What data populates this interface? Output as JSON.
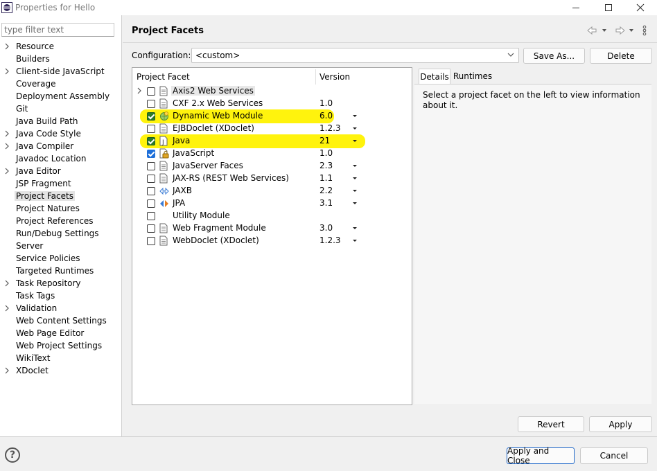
{
  "window": {
    "title": "Properties for Hello"
  },
  "filter": {
    "placeholder": "type filter text"
  },
  "sidebar": {
    "items": [
      {
        "label": "Resource",
        "expandable": true
      },
      {
        "label": "Builders",
        "expandable": false
      },
      {
        "label": "Client-side JavaScript",
        "expandable": true
      },
      {
        "label": "Coverage",
        "expandable": false
      },
      {
        "label": "Deployment Assembly",
        "expandable": false
      },
      {
        "label": "Git",
        "expandable": false
      },
      {
        "label": "Java Build Path",
        "expandable": false
      },
      {
        "label": "Java Code Style",
        "expandable": true
      },
      {
        "label": "Java Compiler",
        "expandable": true
      },
      {
        "label": "Javadoc Location",
        "expandable": false
      },
      {
        "label": "Java Editor",
        "expandable": true
      },
      {
        "label": "JSP Fragment",
        "expandable": false
      },
      {
        "label": "Project Facets",
        "expandable": false,
        "selected": true
      },
      {
        "label": "Project Natures",
        "expandable": false
      },
      {
        "label": "Project References",
        "expandable": false
      },
      {
        "label": "Run/Debug Settings",
        "expandable": false
      },
      {
        "label": "Server",
        "expandable": false
      },
      {
        "label": "Service Policies",
        "expandable": false
      },
      {
        "label": "Targeted Runtimes",
        "expandable": false
      },
      {
        "label": "Task Repository",
        "expandable": true
      },
      {
        "label": "Task Tags",
        "expandable": false
      },
      {
        "label": "Validation",
        "expandable": true
      },
      {
        "label": "Web Content Settings",
        "expandable": false
      },
      {
        "label": "Web Page Editor",
        "expandable": false
      },
      {
        "label": "Web Project Settings",
        "expandable": false
      },
      {
        "label": "WikiText",
        "expandable": false
      },
      {
        "label": "XDoclet",
        "expandable": true
      }
    ]
  },
  "page": {
    "title": "Project Facets"
  },
  "configuration": {
    "label": "Configuration:",
    "value": "<custom>",
    "save_as_label": "Save As...",
    "delete_label": "Delete"
  },
  "facet_table": {
    "headers": {
      "facet": "Project Facet",
      "version": "Version"
    },
    "rows": [
      {
        "name": "Axis2 Web Services",
        "version": "",
        "checked": false,
        "expander": true,
        "has_dropdown": false,
        "icon": "document-icon"
      },
      {
        "name": "CXF 2.x Web Services",
        "version": "1.0",
        "checked": false,
        "has_dropdown": false,
        "icon": "document-icon"
      },
      {
        "name": "Dynamic Web Module",
        "version": "6.0",
        "checked": true,
        "has_dropdown": true,
        "icon": "web-module-icon",
        "highlighted": true
      },
      {
        "name": "EJBDoclet (XDoclet)",
        "version": "1.2.3",
        "checked": false,
        "has_dropdown": true,
        "icon": "document-icon"
      },
      {
        "name": "Java",
        "version": "21",
        "checked": true,
        "has_dropdown": true,
        "icon": "java-icon",
        "highlighted": true
      },
      {
        "name": "JavaScript",
        "version": "1.0",
        "checked": true,
        "has_dropdown": false,
        "icon": "javascript-icon",
        "locked": true
      },
      {
        "name": "JavaServer Faces",
        "version": "2.3",
        "checked": false,
        "has_dropdown": true,
        "icon": "document-icon"
      },
      {
        "name": "JAX-RS (REST Web Services)",
        "version": "1.1",
        "checked": false,
        "has_dropdown": true,
        "icon": "document-icon"
      },
      {
        "name": "JAXB",
        "version": "2.2",
        "checked": false,
        "has_dropdown": true,
        "icon": "jaxb-icon"
      },
      {
        "name": "JPA",
        "version": "3.1",
        "checked": false,
        "has_dropdown": true,
        "icon": "jpa-icon"
      },
      {
        "name": "Utility Module",
        "version": "",
        "checked": false,
        "has_dropdown": false,
        "icon": "none"
      },
      {
        "name": "Web Fragment Module",
        "version": "3.0",
        "checked": false,
        "has_dropdown": true,
        "icon": "document-icon"
      },
      {
        "name": "WebDoclet (XDoclet)",
        "version": "1.2.3",
        "checked": false,
        "has_dropdown": true,
        "icon": "document-icon"
      }
    ]
  },
  "details": {
    "tabs": [
      "Details",
      "Runtimes"
    ],
    "active_tab": "Details",
    "text": "Select a project facet on the left to view information about it."
  },
  "buttons": {
    "revert": "Revert",
    "apply": "Apply",
    "apply_and_close": "Apply and Close",
    "cancel": "Cancel"
  },
  "colors": {
    "highlight": "#fff200",
    "checkbox_blue": "#1e6fd9",
    "checkbox_green": "#2a7a2a",
    "default_button_border": "#1a64c8"
  }
}
